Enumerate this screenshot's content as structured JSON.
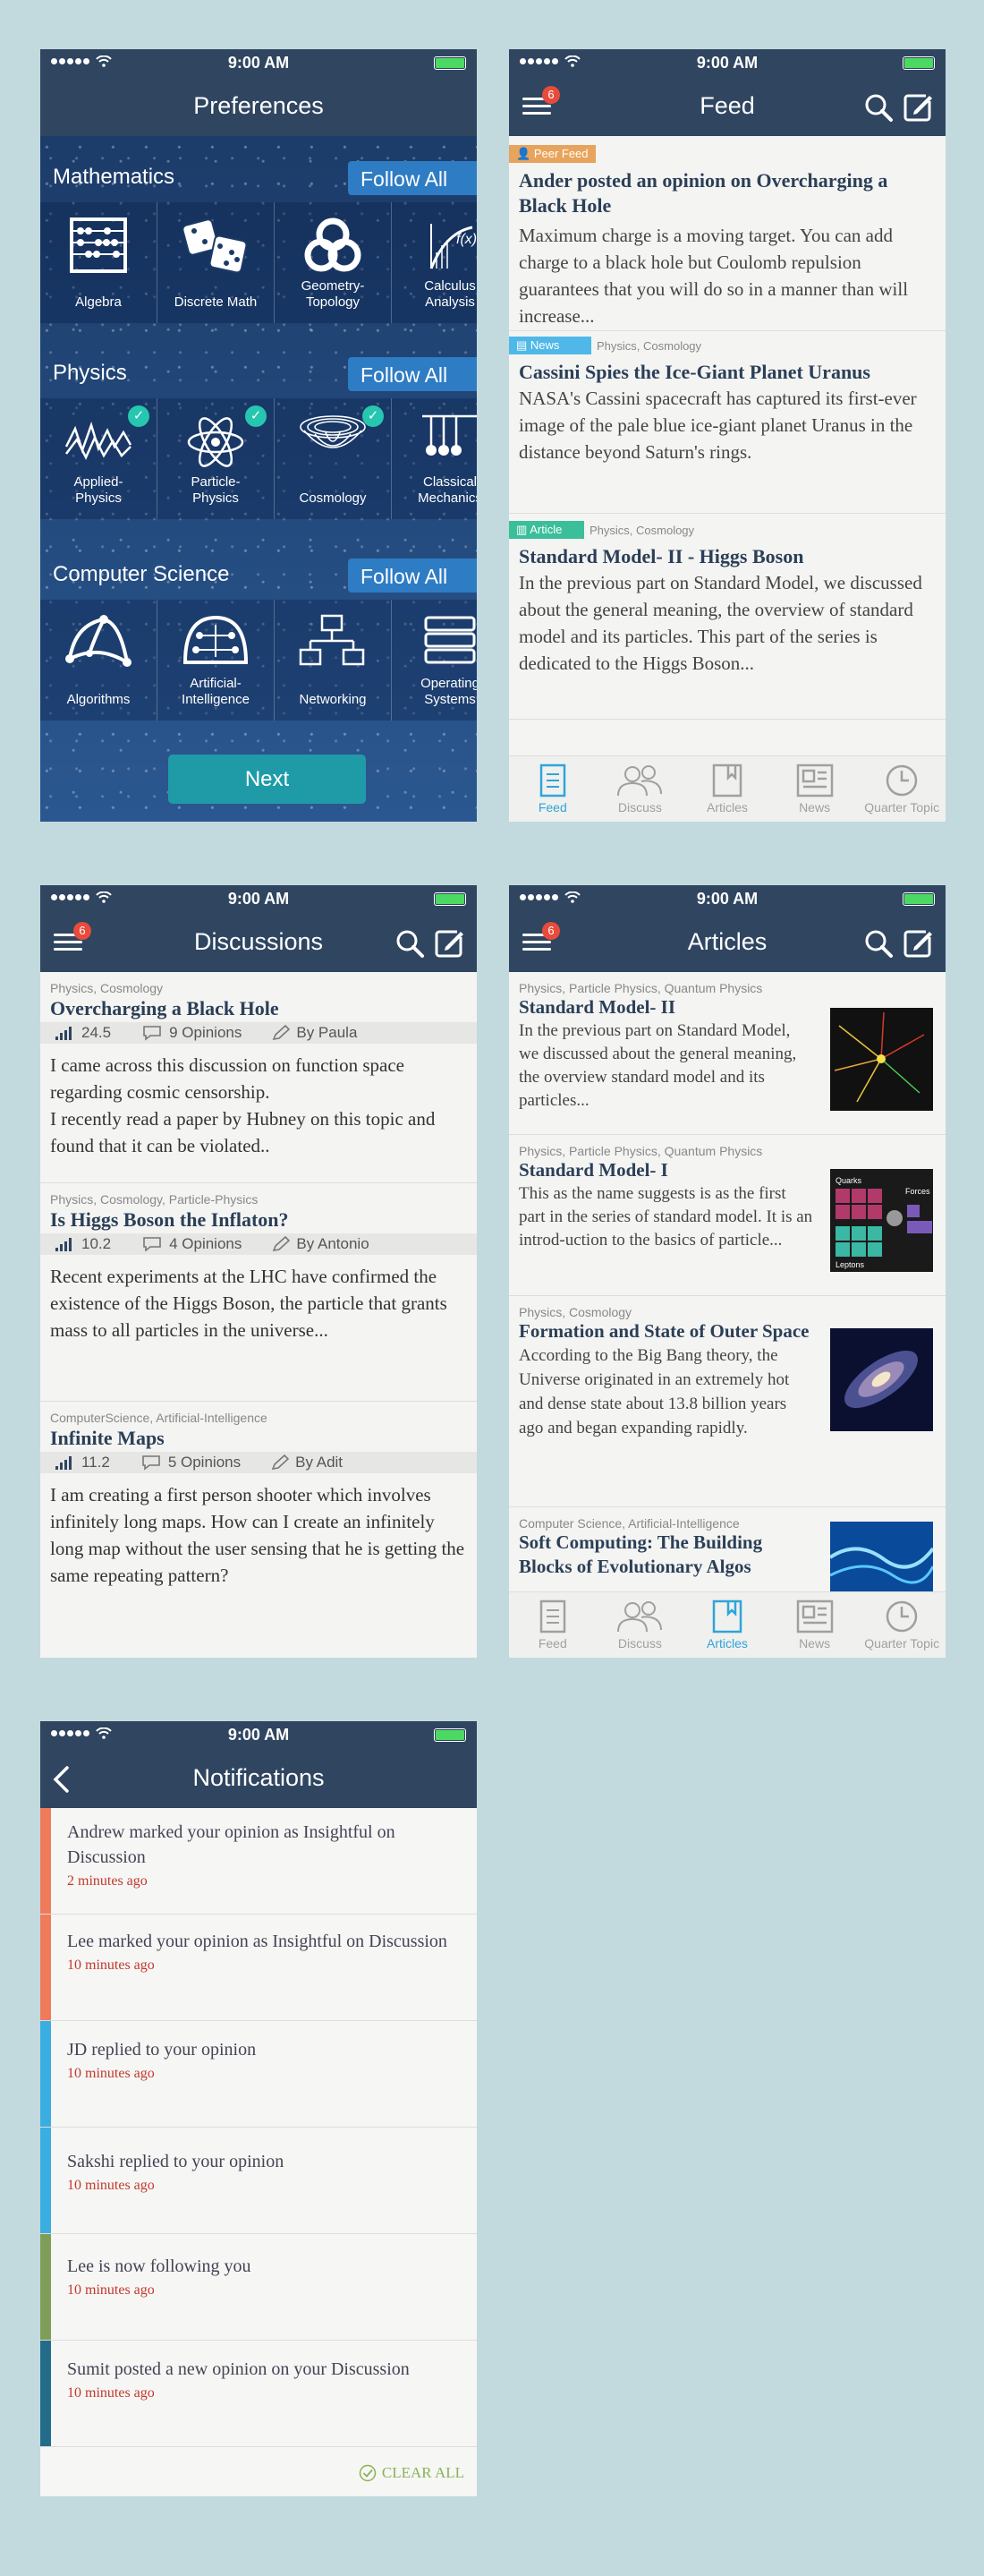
{
  "status": {
    "time": "9:00 AM"
  },
  "preferences": {
    "title": "Preferences",
    "sections": [
      {
        "name": "Mathematics",
        "follow": "Follow All",
        "topics": [
          "Algebra",
          "Discrete Math",
          "Geometry-\nTopology",
          "Calculus\nAnalysis"
        ]
      },
      {
        "name": "Physics",
        "follow": "Follow All",
        "topics": [
          "Applied-\nPhysics",
          "Particle-\nPhysics",
          "Cosmology",
          "Classical\nMechanics"
        ]
      },
      {
        "name": "Computer Science",
        "follow": "Follow All",
        "topics": [
          "Algorithms",
          "Artificial-\nIntelligence",
          "Networking",
          "Operating\nSystems"
        ]
      }
    ],
    "next": "Next"
  },
  "feed": {
    "title": "Feed",
    "badge": "6",
    "items": [
      {
        "tag": "Peer Feed",
        "tag_color": "#e8a45c",
        "categories": "",
        "title": "Ander posted an opinion on Overcharging a Black Hole",
        "body": "Maximum charge is a moving target. You can add charge to a black hole but Coulomb repulsion guarantees that you will do so in a manner than will increase..."
      },
      {
        "tag": "News",
        "tag_color": "#4fb8e8",
        "categories": "Physics, Cosmology",
        "title": "Cassini Spies the Ice-Giant Planet Uranus",
        "body": "NASA's Cassini spacecraft has captured its first-ever image of the pale blue ice-giant planet Uranus in the distance beyond Saturn's rings."
      },
      {
        "tag": "Article",
        "tag_color": "#3bbf9a",
        "categories": "Physics, Cosmology",
        "title": "Standard Model- II - Higgs Boson",
        "body": "In the previous part on Standard Model, we discussed about the general meaning, the overview of standard model and its particles. This part of the series is dedicated to the Higgs Boson..."
      }
    ]
  },
  "tabs": [
    "Feed",
    "Discuss",
    "Articles",
    "News",
    "Quarter Topic"
  ],
  "discussions": {
    "title": "Discussions",
    "badge": "6",
    "items": [
      {
        "categories": "Physics, Cosmology",
        "title": "Overcharging a Black Hole",
        "score": "24.5",
        "opinions": "9 Opinions",
        "author": "By Paula",
        "body": "I came across this discussion on function space regarding cosmic censorship.\nI recently read a paper by Hubney on this topic and found that it can be violated.."
      },
      {
        "categories": "Physics, Cosmology, Particle-Physics",
        "title": "Is Higgs Boson the Inflaton?",
        "score": "10.2",
        "opinions": "4 Opinions",
        "author": "By Antonio",
        "body": "Recent experiments at the LHC have confirmed the existence of the Higgs Boson, the particle that grants mass to all particles in the universe..."
      },
      {
        "categories": "ComputerScience, Artificial-Intelligence",
        "title": "Infinite Maps",
        "score": "11.2",
        "opinions": "5 Opinions",
        "author": "By Adit",
        "body": "I am creating a first person shooter which involves infinitely long maps. How can I create an infinitely long map without the user sensing that he is getting the same repeating pattern?"
      }
    ]
  },
  "articles": {
    "title": "Articles",
    "badge": "6",
    "items": [
      {
        "categories": "Physics, Particle Physics, Quantum Physics",
        "title": "Standard Model- II",
        "body": "In the previous part on Standard Model, we discussed about the general meaning, the overview standard model and its particles..."
      },
      {
        "categories": "Physics, Particle Physics, Quantum Physics",
        "title": "Standard Model- I",
        "body": "This as the name suggests is as the first part in the series of standard model. It is an introd-uction to the basics of particle...",
        "thumb_labels": [
          "Quarks",
          "Forces",
          "Leptons"
        ]
      },
      {
        "categories": "Physics, Cosmology",
        "title": "Formation and State of Outer Space",
        "body": "According to the Big Bang theory, the Universe originated in an extremely hot and dense state about 13.8 billion years ago and began expanding rapidly."
      },
      {
        "categories": "Computer Science, Artificial-Intelligence",
        "title": "Soft Computing: The Building Blocks of Evolutionary Algos",
        "body": ""
      }
    ]
  },
  "notifications": {
    "title": "Notifications",
    "items": [
      {
        "text": "Andrew marked your opinion as Insightful on Discussion",
        "time": "2 minutes ago",
        "color": "#ef7b5c"
      },
      {
        "text": "Lee marked your opinion as Insightful on Discussion",
        "time": "10 minutes ago",
        "color": "#ef7b5c"
      },
      {
        "text": "JD replied to your opinion",
        "time": "10 minutes ago",
        "color": "#3aaee0"
      },
      {
        "text": "Sakshi replied to your opinion",
        "time": "10 minutes ago",
        "color": "#3aaee0"
      },
      {
        "text": "Lee is now following you",
        "time": "10 minutes ago",
        "color": "#7e9e58"
      },
      {
        "text": "Sumit posted a new opinion on your Discussion",
        "time": "10 minutes ago",
        "color": "#236d8a"
      }
    ],
    "clear_all": "CLEAR ALL"
  }
}
